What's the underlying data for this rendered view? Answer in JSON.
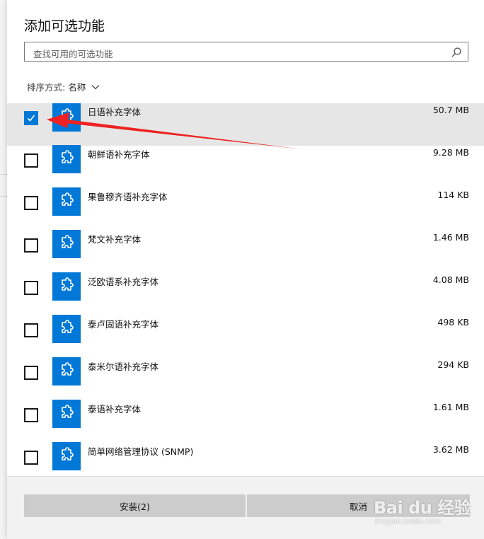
{
  "dialog": {
    "title": "添加可选功能",
    "search": {
      "placeholder": "查找可用的可选功能",
      "icon": "search-icon"
    },
    "sort": {
      "label": "排序方式:",
      "value": "名称",
      "icon": "chevron-down-icon"
    }
  },
  "features": [
    {
      "name": "日语补充字体",
      "size": "50.7 MB",
      "checked": true
    },
    {
      "name": "朝鲜语补充字体",
      "size": "9.28 MB",
      "checked": false
    },
    {
      "name": "果鲁穆齐语补充字体",
      "size": "114 KB",
      "checked": false
    },
    {
      "name": "梵文补充字体",
      "size": "1.46 MB",
      "checked": false
    },
    {
      "name": "泛欧语系补充字体",
      "size": "4.08 MB",
      "checked": false
    },
    {
      "name": "泰卢固语补充字体",
      "size": "498 KB",
      "checked": false
    },
    {
      "name": "泰米尔语补充字体",
      "size": "294 KB",
      "checked": false
    },
    {
      "name": "泰语补充字体",
      "size": "1.61 MB",
      "checked": false
    },
    {
      "name": "简单网络管理协议 (SNMP)",
      "size": "3.62 MB",
      "checked": false
    }
  ],
  "footer": {
    "install_label": "安装(2)",
    "cancel_label": "取消"
  },
  "watermark": {
    "logo": "Bai du 经验",
    "url": "jingyan.baidu.com"
  },
  "colors": {
    "accent": "#0078d7",
    "arrow": "#ee2222",
    "selected_row": "#e6e6e6"
  }
}
